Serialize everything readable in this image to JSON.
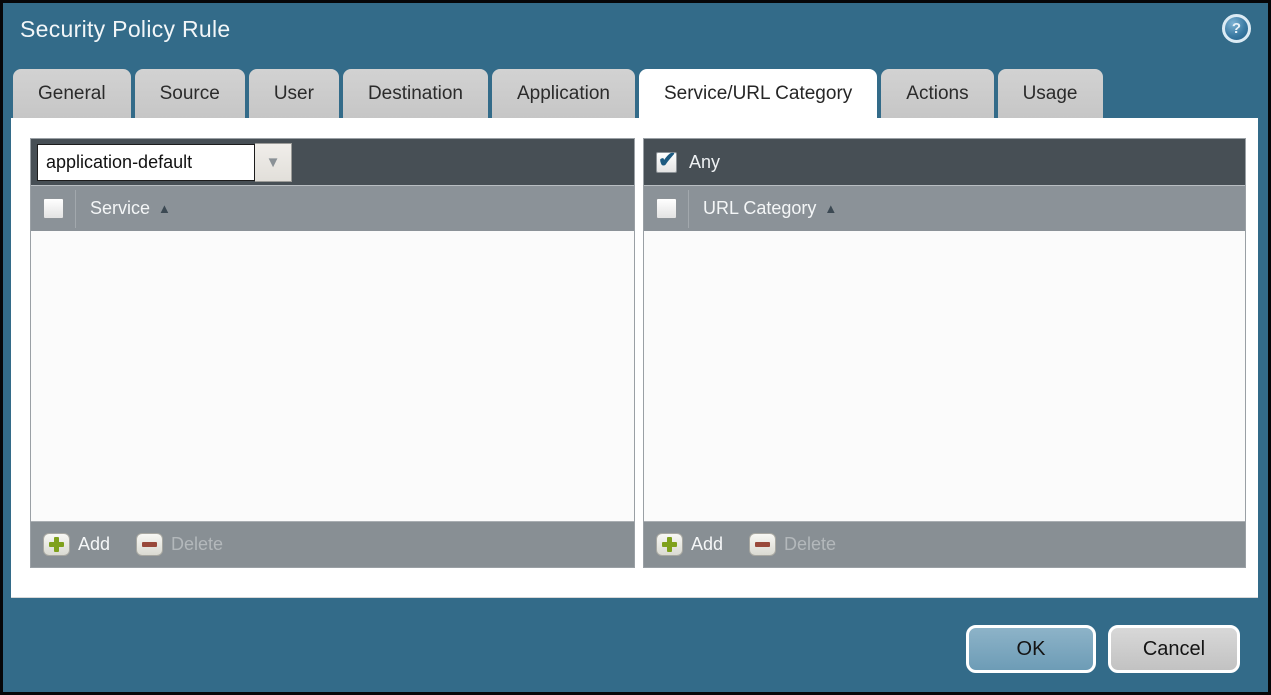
{
  "dialog": {
    "title": "Security Policy Rule",
    "help_icon": "help-icon",
    "help_glyph": "?"
  },
  "tabs": [
    {
      "label": "General",
      "active": false
    },
    {
      "label": "Source",
      "active": false
    },
    {
      "label": "User",
      "active": false
    },
    {
      "label": "Destination",
      "active": false
    },
    {
      "label": "Application",
      "active": false
    },
    {
      "label": "Service/URL Category",
      "active": true
    },
    {
      "label": "Actions",
      "active": false
    },
    {
      "label": "Usage",
      "active": false
    }
  ],
  "service_panel": {
    "dropdown_value": "application-default",
    "dropdown_icon": "chevron-down-icon",
    "header_checkbox_checked": false,
    "column_header": "Service",
    "sort_arrow": "▲",
    "rows": [],
    "toolbar": {
      "add_label": "Add",
      "delete_label": "Delete",
      "delete_disabled": true
    }
  },
  "url_category_panel": {
    "any_label": "Any",
    "any_checked": true,
    "header_checkbox_checked": false,
    "column_header": "URL Category",
    "sort_arrow": "▲",
    "rows": [],
    "toolbar": {
      "add_label": "Add",
      "delete_label": "Delete",
      "delete_disabled": true
    }
  },
  "footer": {
    "ok_label": "OK",
    "cancel_label": "Cancel"
  },
  "colors": {
    "background_teal": "#336b89",
    "panel_dark_bar": "#474f55",
    "panel_header_gray": "#8b9298",
    "toolbar_gray": "#888f94",
    "tab_gray": "#c9c9c9",
    "active_tab": "#ffffff",
    "ok_button": "#7aa6be",
    "cancel_button": "#c9c9c9",
    "add_plus_green": "#7fa11c",
    "delete_minus_red": "#99493b",
    "check_blue": "#1d5a80"
  }
}
